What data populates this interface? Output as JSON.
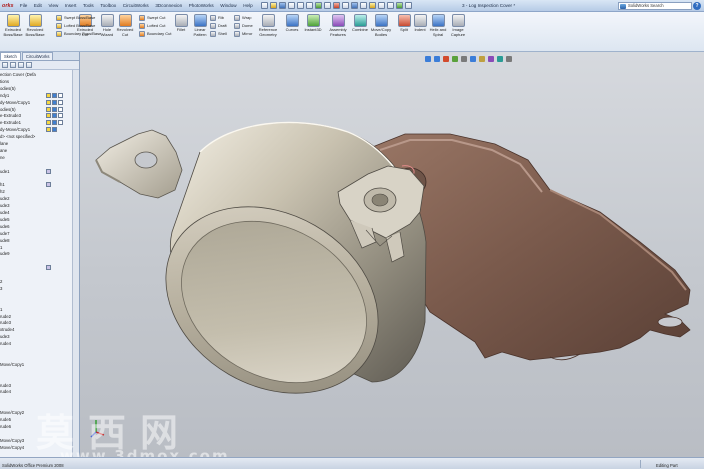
{
  "app": {
    "brand": "orks",
    "doc_title": "3 - Log Inspection Cover *",
    "menus": [
      "File",
      "Edit",
      "View",
      "Insert",
      "Tools",
      "Toolbox",
      "CircuitWorks",
      "3Dconnexion",
      "PhotoWorks",
      "Window",
      "Help"
    ],
    "search_placeholder": "SolidWorks Search",
    "help_glyph": "?"
  },
  "ribbon": {
    "buttons": [
      {
        "label": "Extruded\nBoss/Base",
        "color": "c-yellow"
      },
      {
        "label": "Revolved\nBoss/Base",
        "color": "c-yellow"
      },
      {
        "label": "Extruded\nCut",
        "color": "c-orange"
      },
      {
        "label": "Hole\nWizard",
        "color": "c-gray"
      },
      {
        "label": "Revolved\nCut",
        "color": "c-orange"
      },
      {
        "label": "Fillet",
        "color": "c-gray"
      },
      {
        "label": "Linear\nPattern",
        "color": "c-blue"
      },
      {
        "label": "Reference\nGeometry",
        "color": "c-gray"
      },
      {
        "label": "Curves",
        "color": "c-blue"
      },
      {
        "label": "Instant3D",
        "color": "c-green"
      },
      {
        "label": "Assembly\nFeatures",
        "color": "c-purple"
      },
      {
        "label": "Combine",
        "color": "c-teal"
      },
      {
        "label": "Move/Copy\nBodies",
        "color": "c-blue"
      },
      {
        "label": "Split",
        "color": "c-red"
      },
      {
        "label": "Indent",
        "color": "c-gray"
      },
      {
        "label": "Helix and\nSpiral",
        "color": "c-blue"
      },
      {
        "label": "Image\nCapture",
        "color": "c-gray"
      }
    ],
    "small": [
      {
        "label": "Swept Boss/Base",
        "color": "c-yellow"
      },
      {
        "label": "Lofted Boss/Base",
        "color": "c-yellow"
      },
      {
        "label": "Boundary Boss/Base",
        "color": "c-yellow"
      },
      {
        "label": "Swept Cut",
        "color": "c-orange"
      },
      {
        "label": "Lofted Cut",
        "color": "c-orange"
      },
      {
        "label": "Boundary Cut",
        "color": "c-orange"
      },
      {
        "label": "Rib",
        "color": "c-gray"
      },
      {
        "label": "Draft",
        "color": "c-gray"
      },
      {
        "label": "Shell",
        "color": "c-gray"
      },
      {
        "label": "Wrap",
        "color": "c-gray"
      },
      {
        "label": "Dome",
        "color": "c-gray"
      },
      {
        "label": "Mirror",
        "color": "c-gray"
      }
    ]
  },
  "left_panel": {
    "tabs": [
      "Sketch",
      "CircuitWorks"
    ],
    "tree": [
      "ection Cover  (Defa",
      "tions",
      "odies(5)",
      "ndy1",
      "dy-Move/Copy1",
      "odies(5)",
      "e-Extrude3",
      "e-Extrude1",
      "dy-Move/Copy1",
      "d> <not specified>",
      "lane",
      "ane",
      "ne",
      "",
      "ude1",
      "",
      "h1",
      "h2",
      "ude2",
      "ude3",
      "ude4",
      "ude5",
      "ude6",
      "ude7",
      "ude8",
      "1",
      "ude9",
      "",
      "",
      "",
      "2",
      "3",
      "",
      "",
      "1",
      "rude2",
      "rude3",
      "xtrude4",
      "ude3",
      "rude4",
      "",
      "",
      "Move/Copy1",
      "",
      "",
      "rude3",
      "rude4",
      "",
      "",
      "Move/Copy2",
      "rude5",
      "rude6",
      "",
      "Move/Copy3",
      "Move/Copy4"
    ]
  },
  "status": {
    "left": "SolidWorks Office Premium 2008",
    "right": "Editing Part"
  },
  "watermark": {
    "cn": "莫西网",
    "url": "www.3dmox.com"
  }
}
